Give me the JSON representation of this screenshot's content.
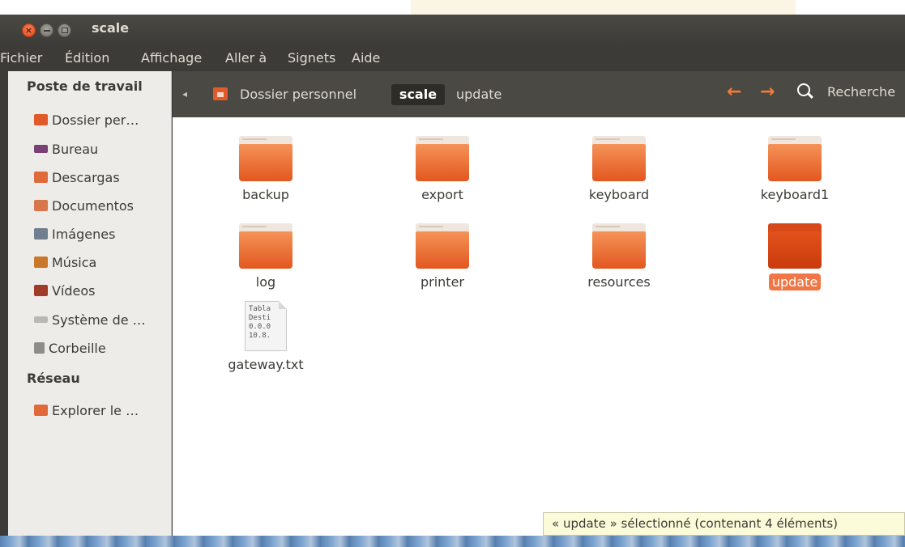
{
  "window": {
    "title": "scale"
  },
  "menubar": [
    "Fichier",
    "Édition",
    "Affichage",
    "Aller à",
    "Signets",
    "Aide"
  ],
  "sidebar": {
    "section_places": "Poste de travail",
    "places": [
      {
        "label": "Dossier per…",
        "icon": "home-folder-icon"
      },
      {
        "label": "Bureau",
        "icon": "desktop-icon"
      },
      {
        "label": "Descargas",
        "icon": "downloads-folder-icon"
      },
      {
        "label": "Documentos",
        "icon": "documents-folder-icon"
      },
      {
        "label": "Imágenes",
        "icon": "pictures-folder-icon"
      },
      {
        "label": "Música",
        "icon": "music-folder-icon"
      },
      {
        "label": "Vídeos",
        "icon": "videos-folder-icon"
      },
      {
        "label": "Système de …",
        "icon": "filesystem-icon"
      },
      {
        "label": "Corbeille",
        "icon": "trash-icon"
      }
    ],
    "section_network": "Réseau",
    "network": [
      {
        "label": "Explorer le …",
        "icon": "network-icon"
      }
    ]
  },
  "pathbar": {
    "crumbs": [
      "Dossier personnel",
      "scale",
      "update"
    ],
    "active_crumb": "scale",
    "search_label": "Recherche"
  },
  "files": [
    {
      "name": "backup",
      "type": "folder"
    },
    {
      "name": "export",
      "type": "folder"
    },
    {
      "name": "keyboard",
      "type": "folder"
    },
    {
      "name": "keyboard1",
      "type": "folder"
    },
    {
      "name": "log",
      "type": "folder"
    },
    {
      "name": "printer",
      "type": "folder"
    },
    {
      "name": "resources",
      "type": "folder"
    },
    {
      "name": "update",
      "type": "folder",
      "selected": true
    },
    {
      "name": "gateway.txt",
      "type": "text",
      "preview": [
        "Tabla",
        "Desti",
        "0.0.0",
        "10.8."
      ]
    }
  ],
  "status": "« update » sélectionné (contenant 4 éléments)",
  "colors": {
    "accent": "#f07745",
    "folder": "#e2571f",
    "sidebar_bg": "#edece8",
    "chrome": "#3c3b37"
  }
}
